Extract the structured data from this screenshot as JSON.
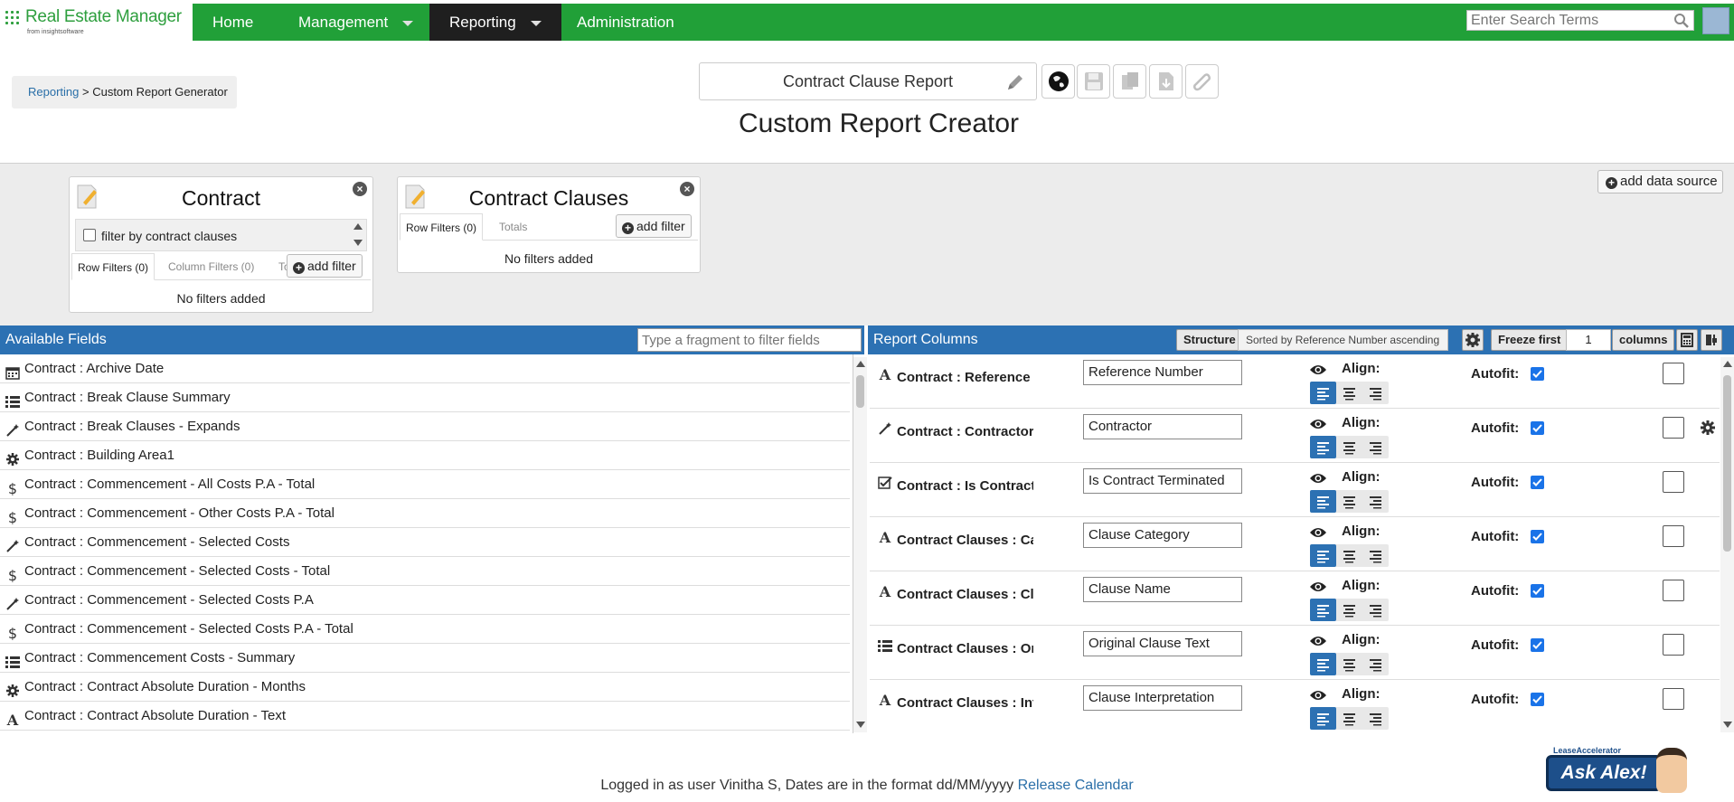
{
  "app": {
    "brand": "Real Estate Manager",
    "brand_sub": "from insightsoftware",
    "search_placeholder": "Enter Search Terms"
  },
  "nav": {
    "items": [
      {
        "label": "Home"
      },
      {
        "label": "Management"
      },
      {
        "label": "Reporting"
      },
      {
        "label": "Administration"
      }
    ]
  },
  "breadcrumb": {
    "link": "Reporting",
    "separator": " > ",
    "current": "Custom Report Generator"
  },
  "report": {
    "name": "Contract Clause Report",
    "page_title": "Custom Report Creator"
  },
  "data_sources": {
    "add_label": "add data source",
    "cards": [
      {
        "title": "Contract",
        "checkbox_label": "filter by contract clauses",
        "tabs": [
          "Row Filters (0)",
          "Column Filters (0)",
          "To"
        ],
        "add_filter": "add filter",
        "empty": "No filters added"
      },
      {
        "title": "Contract Clauses",
        "tabs": [
          "Row Filters (0)",
          "Totals"
        ],
        "add_filter": "add filter",
        "empty": "No filters added"
      }
    ]
  },
  "available_fields": {
    "title": "Available Fields",
    "filter_placeholder": "Type a fragment to filter fields",
    "items": [
      {
        "icon": "calendar-icon",
        "label": "Contract : Archive Date"
      },
      {
        "icon": "list-icon",
        "label": "Contract : Break Clause Summary"
      },
      {
        "icon": "wand-icon",
        "label": "Contract : Break Clauses - Expands"
      },
      {
        "icon": "cog-icon",
        "label": "Contract : Building Area1"
      },
      {
        "icon": "dollar-icon",
        "label": "Contract : Commencement - All Costs P.A - Total"
      },
      {
        "icon": "dollar-icon",
        "label": "Contract : Commencement - Other Costs P.A - Total"
      },
      {
        "icon": "wand-icon",
        "label": "Contract : Commencement - Selected Costs"
      },
      {
        "icon": "dollar-icon",
        "label": "Contract : Commencement - Selected Costs - Total"
      },
      {
        "icon": "wand-icon",
        "label": "Contract : Commencement - Selected Costs P.A"
      },
      {
        "icon": "dollar-icon",
        "label": "Contract : Commencement - Selected Costs P.A - Total"
      },
      {
        "icon": "list-icon",
        "label": "Contract : Commencement Costs - Summary"
      },
      {
        "icon": "cog-icon",
        "label": "Contract : Contract Absolute Duration - Months"
      },
      {
        "icon": "text-icon",
        "label": "Contract : Contract Absolute Duration - Text"
      }
    ]
  },
  "report_columns": {
    "title": "Report Columns",
    "structure_label": "Structure",
    "sort_label": "Sorted by Reference Number ascending",
    "freeze_label": "Freeze first",
    "freeze_value": "1",
    "columns_label": "columns",
    "align_label": "Align:",
    "autofit_label": "Autofit:",
    "items": [
      {
        "icon": "text-icon",
        "name": "Contract : Reference Number",
        "value": "Reference Number",
        "autofit": true,
        "has_gear": false
      },
      {
        "icon": "wand-icon",
        "name": "Contract : Contractor",
        "value": "Contractor",
        "autofit": true,
        "has_gear": true
      },
      {
        "icon": "checkbox-icon",
        "name": "Contract : Is Contract Terminated",
        "value": "Is Contract Terminated",
        "autofit": true,
        "has_gear": false
      },
      {
        "icon": "text-icon",
        "name": "Contract Clauses : Category",
        "value": "Clause Category",
        "autofit": true,
        "has_gear": false
      },
      {
        "icon": "text-icon",
        "name": "Contract Clauses : Clause Name",
        "value": "Clause Name",
        "autofit": true,
        "has_gear": false
      },
      {
        "icon": "list-icon",
        "name": "Contract Clauses : Original Clause Text",
        "value": "Original Clause Text",
        "autofit": true,
        "has_gear": false
      },
      {
        "icon": "text-icon",
        "name": "Contract Clauses : Interpretation",
        "value": "Clause Interpretation",
        "autofit": true,
        "has_gear": false
      }
    ]
  },
  "footer": {
    "text": "Logged in as user Vinitha S, Dates are in the format dd/MM/yyyy ",
    "link": "Release Calendar"
  },
  "ask_alex": {
    "small": "LeaseAccelerator",
    "label": "Ask Alex!"
  },
  "colors": {
    "nav_green": "#21a038",
    "nav_active": "#1f1f1f",
    "panel_blue": "#2c71b3",
    "brand_green": "#2e9f3e"
  }
}
